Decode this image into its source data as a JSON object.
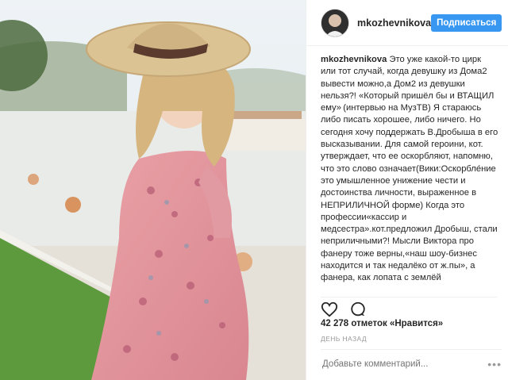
{
  "post": {
    "username": "mkozhevnikova",
    "follow_label": "Подписаться",
    "caption_author": "mkozhevnikova",
    "caption_text": "Это уже какой-то цирк  или тот случай, когда девушку из Дома2 вывести можно,а Дом2 из девушки нельзя?! «Который пришёл бы и ВТАЩИЛ ему» (интервью на МузТВ) Я стараюсь либо писать хорошее, либо ничего. Но сегодня хочу поддержать В.Дробыша в его высказывании. Для самой героини, кот. утверждает, что ее оскорбляют, напомню, что это слово означает(Вики:Оскорбле́ние это умышленное унижение чести и достоинства личности, выраженное в НЕПРИЛИЧНОЙ форме) Когда это профессии«кассир и медсестра».кот.предложил Дробыш, стали неприличными?! Мысли Виктора про фанеру тоже верны,«наш шоу-бизнес находится и так недалёко от ж.пы», а фанера, как лопата с землёй",
    "likes": "42 278 отметок «Нравится»",
    "time": "ДЕНЬ НАЗАД",
    "comment_placeholder": "Добавьте комментарий...",
    "more": "•••"
  },
  "icons": [
    "heart-icon",
    "comment-icon"
  ],
  "colors": {
    "accent": "#3897f0",
    "muted": "#999999",
    "border": "#efefef"
  }
}
